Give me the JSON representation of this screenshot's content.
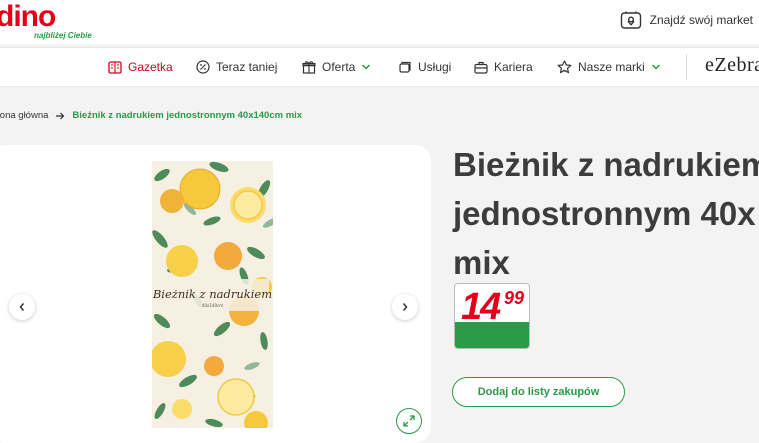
{
  "header": {
    "logo_text": "dino",
    "logo_tagline": "najbliżej Ciebie",
    "find_market_label": "Znajdź swój market"
  },
  "nav": {
    "items": [
      {
        "label": "Gazetka"
      },
      {
        "label": "Teraz taniej"
      },
      {
        "label": "Oferta"
      },
      {
        "label": "Usługi"
      },
      {
        "label": "Kariera"
      },
      {
        "label": "Nasze marki"
      }
    ],
    "partner_logo": "eZebra"
  },
  "breadcrumb": {
    "home": "trona główna",
    "current": "Bieżnik z nadrukiem jednostronnym 40x140cm mix"
  },
  "product": {
    "title_lines": [
      "Bieżnik z nadrukiem",
      "jednostronnym 40x",
      "mix"
    ],
    "image_text": "Bieżnik z nadrukiem",
    "image_subtext": "40x140cm",
    "price_int": "14",
    "price_dec": "99",
    "add_to_list_label": "Dodaj do listy zakupów"
  },
  "colors": {
    "brand_red": "#e4001b",
    "brand_green": "#2a9a48",
    "title_gray": "#3c3c3c"
  }
}
